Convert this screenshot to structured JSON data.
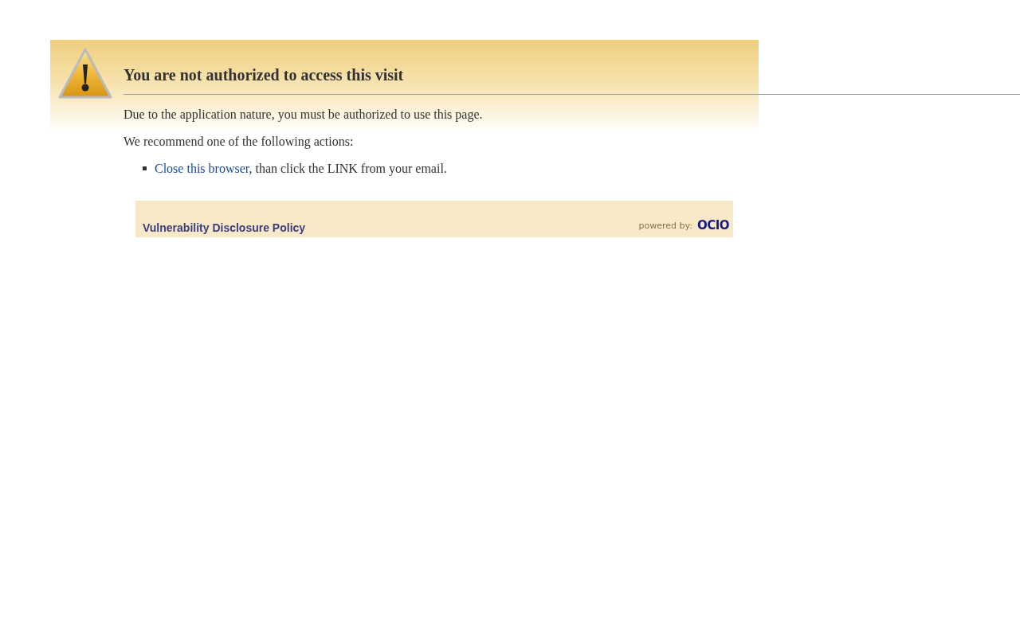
{
  "heading": "You are not authorized to access this visit",
  "message": "Due to the application nature, you must be authorized to use this page.",
  "recommendation": "We recommend one of the following actions:",
  "actions": [
    {
      "link": "Close this browser",
      "text": ", than click the LINK from your email."
    }
  ],
  "footer": {
    "link": "Vulnerability Disclosure Policy",
    "powered_by": "powered by:",
    "logo": "OCIO"
  }
}
